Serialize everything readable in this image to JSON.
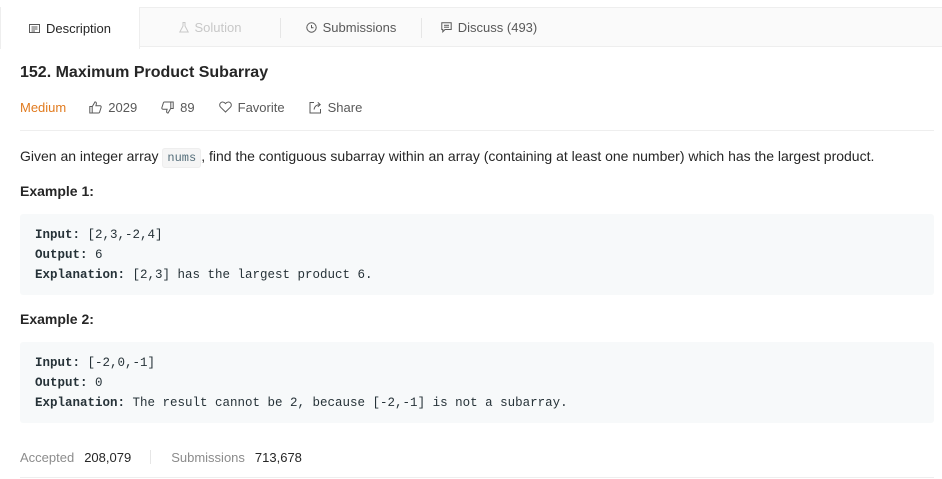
{
  "tabs": {
    "description": "Description",
    "solution": "Solution",
    "submissions": "Submissions",
    "discuss": "Discuss (493)"
  },
  "problem": {
    "title": "152. Maximum Product Subarray",
    "difficulty": "Medium",
    "likes": "2029",
    "dislikes": "89",
    "favorite": "Favorite",
    "share": "Share",
    "difficulty_color": "#e17b1f"
  },
  "description": {
    "before": "Given an integer array ",
    "code": "nums",
    "after": ", find the contiguous subarray within an array (containing at least one number) which has the largest product."
  },
  "examples": [
    {
      "title": "Example 1:",
      "input_label": "Input:",
      "input": " [2,3,-2,4]",
      "output_label": "Output:",
      "output": " 6",
      "explanation_label": "Explanation:",
      "explanation": " [2,3] has the largest product 6."
    },
    {
      "title": "Example 2:",
      "input_label": "Input:",
      "input": " [-2,0,-1]",
      "output_label": "Output:",
      "output": " 0",
      "explanation_label": "Explanation:",
      "explanation": " The result cannot be 2, because [-2,-1] is not a subarray."
    }
  ],
  "stats": {
    "accepted_label": "Accepted",
    "accepted_value": "208,079",
    "submissions_label": "Submissions",
    "submissions_value": "713,678"
  },
  "icons": {
    "description": "document-icon",
    "solution": "flask-icon",
    "submissions": "clock-icon",
    "discuss": "comment-icon",
    "like": "thumbs-up-icon",
    "dislike": "thumbs-down-icon",
    "favorite": "heart-icon",
    "share": "share-icon"
  }
}
